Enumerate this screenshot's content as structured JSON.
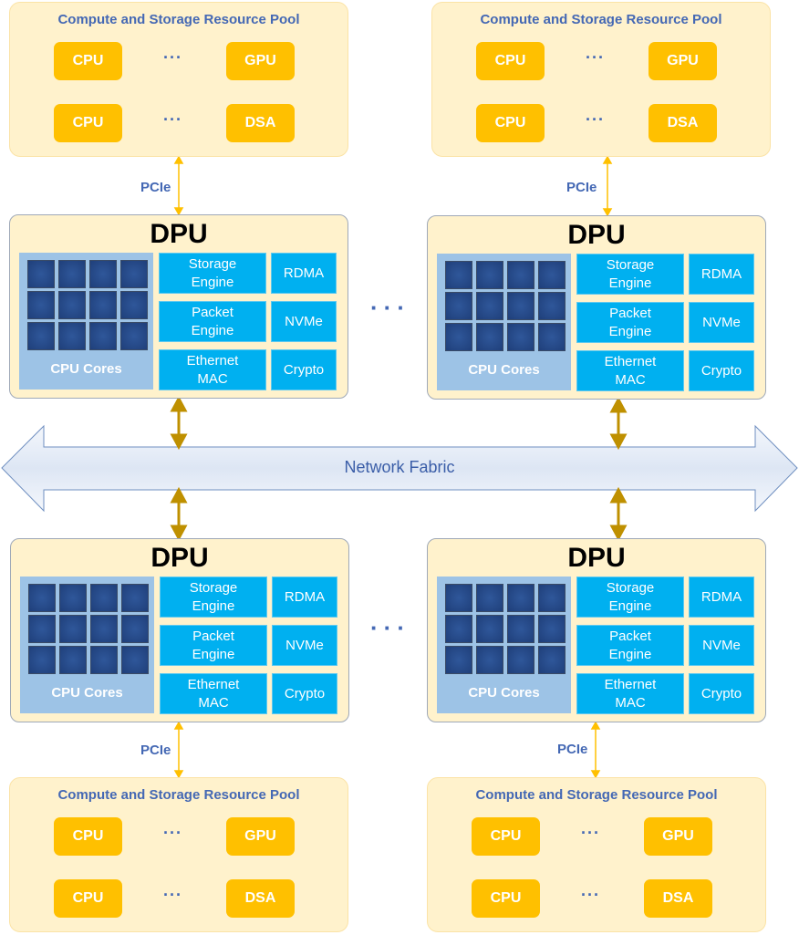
{
  "pool_title": "Compute and Storage Resource Pool",
  "pool_chips": [
    "CPU",
    "GPU",
    "CPU",
    "DSA"
  ],
  "ellipsis": "···",
  "link_label": "PCIe",
  "dpu": {
    "title": "DPU",
    "cores_label": "CPU Cores",
    "engines": [
      "Storage Engine",
      "Packet Engine",
      "Ethernet MAC"
    ],
    "accelerators": [
      "RDMA",
      "NVMe",
      "Crypto"
    ]
  },
  "fabric_label": "Network Fabric",
  "between_dpus": "···",
  "colors": {
    "pool_bg": "#fff2cc",
    "chip": "#ffc000",
    "block": "#00b0f0",
    "cores_panel": "#9dc3e6",
    "fabric_link": "#bf9000",
    "pcie_link": "#ffc000",
    "label": "#4468b4"
  }
}
